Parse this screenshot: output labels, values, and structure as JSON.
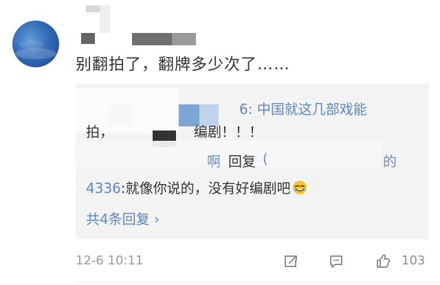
{
  "comment": {
    "text": "别翻拍了，翻牌多少次了……"
  },
  "reply_box": {
    "first_reply_suffix": "6: 中国就这几部戏能",
    "first_reply_line2_prefix": "拍，",
    "first_reply_line2_suffix": "编剧！！！",
    "second_header_partial": "啊",
    "second_header_reply": "回复",
    "second_header_paren": "(",
    "second_header_tail": "的",
    "second_reply_name": "4336",
    "second_reply_text": ":就像你说的，没有好编剧吧",
    "view_all": "共4条回复 ›"
  },
  "footer": {
    "timestamp": "12-6 10:11",
    "like_count": "103"
  },
  "colors": {
    "link_blue": "#5d87bf",
    "text_primary": "#333333",
    "text_secondary": "#9a9a9a",
    "reply_bg": "#f3f3f3"
  },
  "icons": {
    "share": "share-icon",
    "comment": "comment-icon",
    "like": "thumb-up-icon",
    "emoji": "laughing-tears-emoji"
  }
}
